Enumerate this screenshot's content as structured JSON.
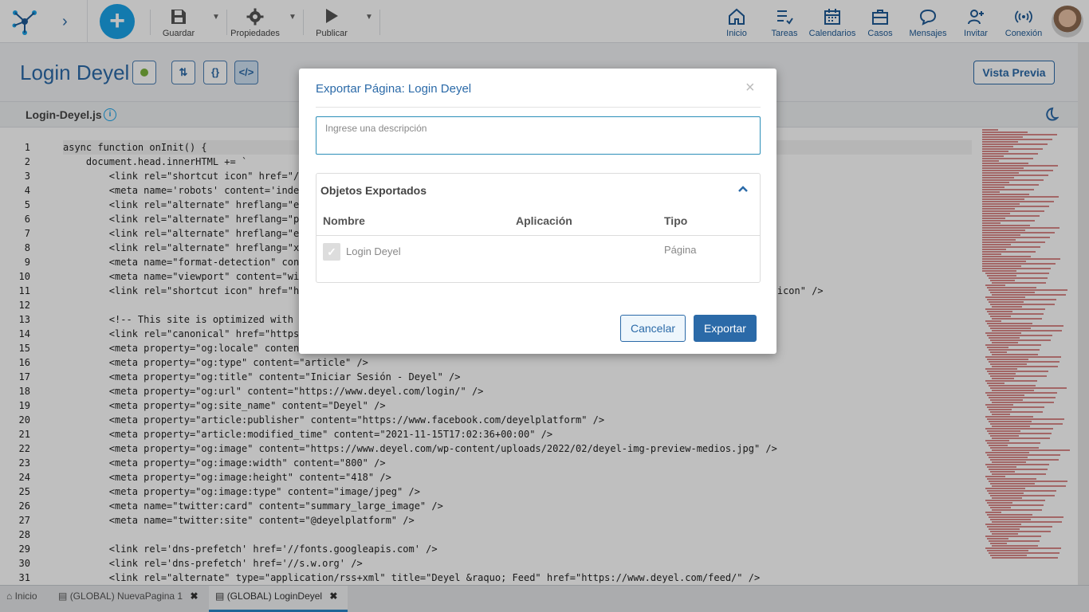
{
  "toolbar": {
    "save": "Guardar",
    "properties": "Propiedades",
    "publish": "Publicar"
  },
  "nav": {
    "home": "Inicio",
    "tasks": "Tareas",
    "calendars": "Calendarios",
    "cases": "Casos",
    "messages": "Mensajes",
    "invite": "Invitar",
    "connection": "Conexión"
  },
  "page": {
    "title": "Login Deyel",
    "preview": "Vista Previa",
    "btn_flow": "⇅",
    "btn_braces": "{}",
    "btn_code": "</>",
    "status_color": "#7bb33c"
  },
  "editor": {
    "file_name": "Login-Deyel.js",
    "info": "i",
    "line_numbers": [
      "1",
      "2",
      "3",
      "4",
      "5",
      "6",
      "7",
      "8",
      "9",
      "10",
      "11",
      "12",
      "13",
      "14",
      "15",
      "16",
      "17",
      "18",
      "19",
      "20",
      "21",
      "22",
      "23",
      "24",
      "25",
      "26",
      "27",
      "28",
      "29",
      "30",
      "31"
    ],
    "lines": [
      "async function onInit() {",
      "    document.head.innerHTML += `",
      "        <link rel=\"shortcut icon\" href=\"/t",
      "        <meta name='robots' content='index",
      "        <link rel=\"alternate\" hreflang=\"es",
      "        <link rel=\"alternate\" hreflang=\"pt",
      "        <link rel=\"alternate\" hreflang=\"en",
      "        <link rel=\"alternate\" hreflang=\"x-",
      "        <meta name=\"format-detection\" cont",
      "        <meta name=\"viewport\" content=\"wic",
      "        <link rel=\"shortcut icon\" href=\"ht                                                                                  icon\" />",
      "",
      "        <!-- This site is optimized with t",
      "        <link rel=\"canonical\" href=\"https:",
      "        <meta property=\"og:locale\" content",
      "        <meta property=\"og:type\" content=\"article\" />",
      "        <meta property=\"og:title\" content=\"Iniciar Sesión - Deyel\" />",
      "        <meta property=\"og:url\" content=\"https://www.deyel.com/login/\" />",
      "        <meta property=\"og:site_name\" content=\"Deyel\" />",
      "        <meta property=\"article:publisher\" content=\"https://www.facebook.com/deyelplatform\" />",
      "        <meta property=\"article:modified_time\" content=\"2021-11-15T17:02:36+00:00\" />",
      "        <meta property=\"og:image\" content=\"https://www.deyel.com/wp-content/uploads/2022/02/deyel-img-preview-medios.jpg\" />",
      "        <meta property=\"og:image:width\" content=\"800\" />",
      "        <meta property=\"og:image:height\" content=\"418\" />",
      "        <meta property=\"og:image:type\" content=\"image/jpeg\" />",
      "        <meta name=\"twitter:card\" content=\"summary_large_image\" />",
      "        <meta name=\"twitter:site\" content=\"@deyelplatform\" />",
      "",
      "        <link rel='dns-prefetch' href='//fonts.googleapis.com' />",
      "        <link rel='dns-prefetch' href='//s.w.org' />",
      "        <link rel=\"alternate\" type=\"application/rss+xml\" title=\"Deyel &raquo; Feed\" href=\"https://www.deyel.com/feed/\" />"
    ]
  },
  "tabs": [
    {
      "label": "Inicio",
      "close": ""
    },
    {
      "label": "(GLOBAL) NuevaPagina 1",
      "close": "✖"
    },
    {
      "label": "(GLOBAL) LoginDeyel",
      "close": "✖"
    }
  ],
  "modal": {
    "title": "Exportar Página: Login Deyel",
    "close": "×",
    "description_placeholder": "Ingrese una descripción",
    "section_title": "Objetos Exportados",
    "columns": [
      "Nombre",
      "Aplicación",
      "Tipo"
    ],
    "rows": [
      {
        "name": "Login Deyel",
        "app": "",
        "type": "Página",
        "checked": true
      }
    ],
    "cancel": "Cancelar",
    "export": "Exportar"
  }
}
